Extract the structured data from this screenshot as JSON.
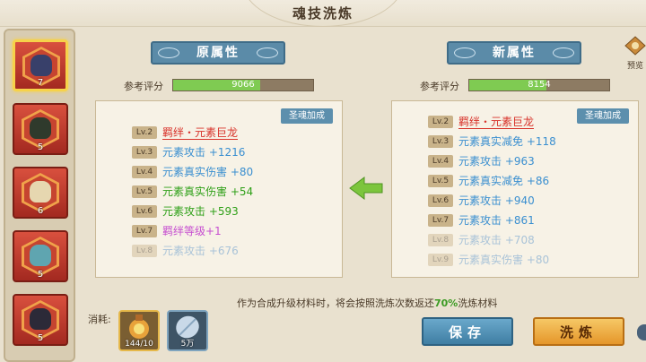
{
  "title": "魂技洗炼",
  "roster": [
    {
      "level": "7",
      "avatar_color": "#38406a",
      "selected": true
    },
    {
      "level": "5",
      "avatar_color": "#2f3a2c",
      "selected": false
    },
    {
      "level": "6",
      "avatar_color": "#e6d7b0",
      "selected": false
    },
    {
      "level": "5",
      "avatar_color": "#5fa5b0",
      "selected": false
    },
    {
      "level": "5",
      "avatar_color": "#2c2a38",
      "selected": false
    }
  ],
  "left_panel": {
    "header": "原属性",
    "score_label": "参考评分",
    "score_value": "9066",
    "score_fill": 0.62,
    "soul_button": "圣魂加成",
    "rows": [
      {
        "lv": "Lv.2",
        "text": "羁绊・元素巨龙",
        "color": "#d8322a",
        "underline": true
      },
      {
        "lv": "Lv.3",
        "text": "元素攻击 +1216",
        "color": "#3a8fd0"
      },
      {
        "lv": "Lv.4",
        "text": "元素真实伤害 +80",
        "color": "#3a8fd0"
      },
      {
        "lv": "Lv.5",
        "text": "元素真实伤害 +54",
        "color": "#2fa018"
      },
      {
        "lv": "Lv.6",
        "text": "元素攻击 +593",
        "color": "#2fa018"
      },
      {
        "lv": "Lv.7",
        "text": "羁绊等级+1",
        "color": "#c64fd0"
      },
      {
        "lv": "Lv.8",
        "text": "元素攻击 +676",
        "color": "#a9c3d8",
        "faded": true
      }
    ]
  },
  "right_panel": {
    "header": "新属性",
    "score_label": "参考评分",
    "score_value": "8154",
    "score_fill": 0.55,
    "soul_button": "圣魂加成",
    "rows": [
      {
        "lv": "Lv.2",
        "text": "羁绊・元素巨龙",
        "color": "#d8322a",
        "underline": true
      },
      {
        "lv": "Lv.3",
        "text": "元素真实减免 +118",
        "color": "#3a8fd0"
      },
      {
        "lv": "Lv.4",
        "text": "元素攻击 +963",
        "color": "#3a8fd0"
      },
      {
        "lv": "Lv.5",
        "text": "元素真实减免 +86",
        "color": "#3a8fd0"
      },
      {
        "lv": "Lv.6",
        "text": "元素攻击 +940",
        "color": "#3a8fd0"
      },
      {
        "lv": "Lv.7",
        "text": "元素攻击 +861",
        "color": "#3a8fd0"
      },
      {
        "lv": "Lv.8",
        "text": "元素攻击 +708",
        "color": "#a9c3d8",
        "faded": true
      },
      {
        "lv": "Lv.9",
        "text": "元素真实伤害 +80",
        "color": "#a9c3d8",
        "faded": true
      }
    ]
  },
  "note": {
    "prefix": "作为合成升级材料时，将会按照洗炼次数返还",
    "percent": "70%",
    "suffix": "洗炼材料"
  },
  "consume_label": "消耗:",
  "items": [
    {
      "count": "144/10",
      "icon": "potion-icon"
    },
    {
      "count": "5万",
      "icon": "leaf-coin-icon"
    }
  ],
  "buttons": {
    "save": "保存",
    "refine": "洗炼",
    "preview": "预览"
  },
  "colors": {
    "accent_blue": "#5b8ba8",
    "score_green": "#7fcb52",
    "arrow_green": "#7cc53d"
  }
}
